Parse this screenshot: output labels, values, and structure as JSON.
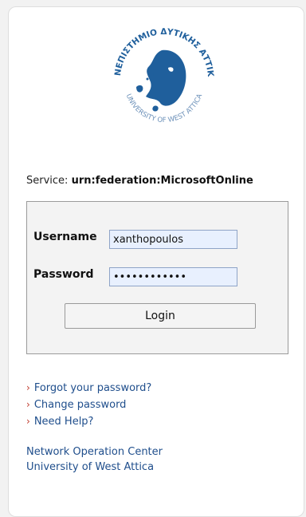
{
  "logo": {
    "top_text": "ΠΑΝΕΠΙΣΤΗΜΙΟ ΔΥΤΙΚΗΣ ΑΤΤΙΚΗΣ",
    "bottom_text": "UNIVERSITY OF WEST ATTICA",
    "color": "#1f5f9c"
  },
  "service": {
    "label": "Service:",
    "value": "urn:federation:MicrosoftOnline"
  },
  "login_form": {
    "username_label": "Username",
    "username_value": "xanthopoulos",
    "password_label": "Password",
    "password_value": "••••••••••••",
    "login_button": "Login"
  },
  "links": {
    "forgot_password": "Forgot your password?",
    "change_password": "Change password",
    "need_help": "Need Help?",
    "chevron": "›"
  },
  "footer": {
    "line1": "Network Operation Center",
    "line2": "University of West Attica"
  }
}
